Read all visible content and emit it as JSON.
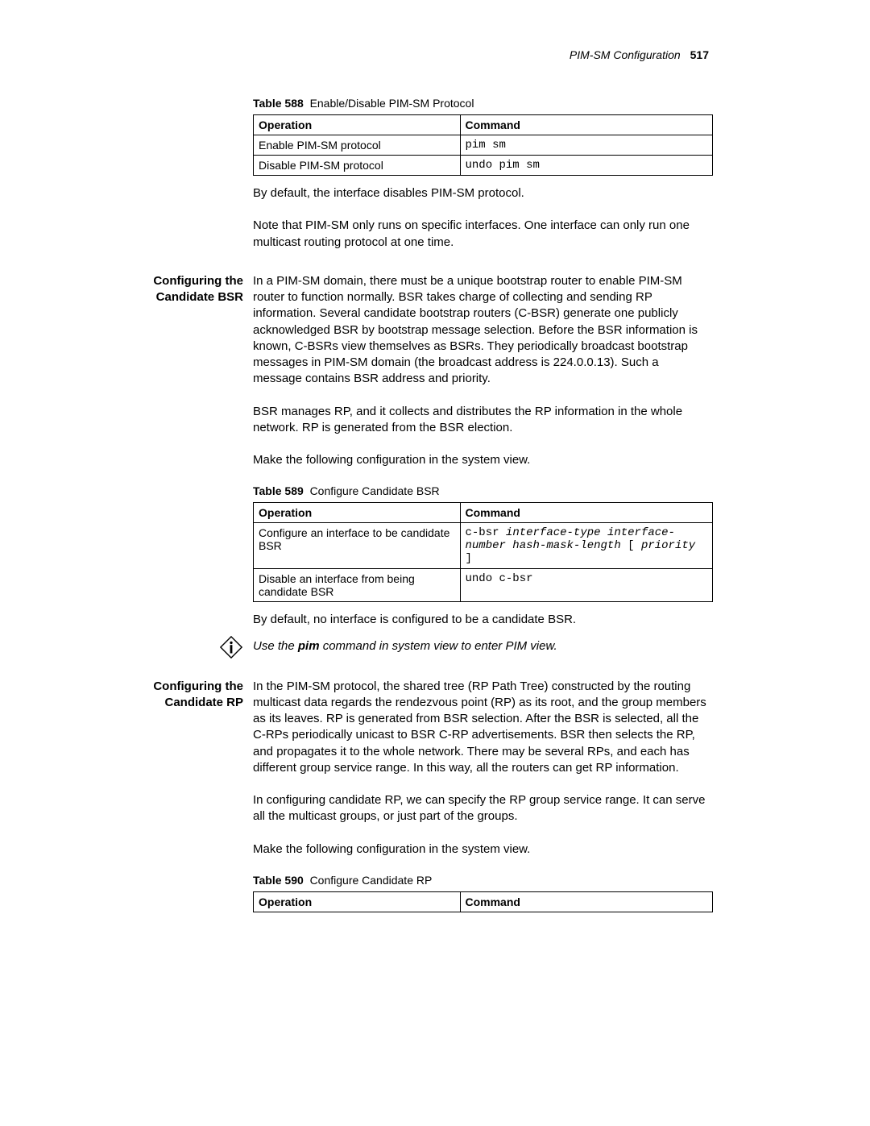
{
  "header": {
    "title": "PIM-SM Configuration",
    "page_number": "517"
  },
  "table588": {
    "label_prefix": "Table 588",
    "label_text": "Enable/Disable PIM-SM Protocol",
    "head_op": "Operation",
    "head_cmd": "Command",
    "rows": [
      {
        "op": "Enable PIM-SM protocol",
        "cmd": "pim sm"
      },
      {
        "op": "Disable PIM-SM protocol",
        "cmd": "undo pim sm"
      }
    ]
  },
  "para_default_588": "By default, the interface disables PIM-SM protocol.",
  "para_note_588": "Note that PIM-SM only runs on specific interfaces. One interface can only run one multicast routing protocol at one time.",
  "section_bsr": {
    "heading_line1": "Configuring the",
    "heading_line2": "Candidate BSR",
    "para1": "In a PIM-SM domain, there must be a unique bootstrap router to enable PIM-SM router to function normally. BSR takes charge of collecting and sending RP information. Several candidate bootstrap routers (C-BSR) generate one publicly acknowledged BSR by bootstrap message selection. Before the BSR information is known, C-BSRs view themselves as BSRs. They periodically broadcast bootstrap messages in PIM-SM domain (the broadcast address is 224.0.0.13). Such a message contains BSR address and priority.",
    "para2": "BSR manages RP, and it collects and distributes the RP information in the whole network. RP is generated from the BSR election.",
    "para3": "Make the following configuration in the system view."
  },
  "table589": {
    "label_prefix": "Table 589",
    "label_text": "Configure Candidate BSR",
    "head_op": "Operation",
    "head_cmd": "Command",
    "row1_op": "Configure an interface to be candidate BSR",
    "row1_cmd_plain1": "c-bsr ",
    "row1_cmd_ital1": "interface-type interface-number hash-mask-length",
    "row1_cmd_plain2": " [ ",
    "row1_cmd_ital2": "priority",
    "row1_cmd_plain3": " ]",
    "row2_op": "Disable an interface from being candidate BSR",
    "row2_cmd": "undo c-bsr"
  },
  "para_default_589": "By default, no interface is configured to be a candidate BSR.",
  "note": {
    "pre": "Use the ",
    "bold": "pim",
    "post": " command in system view to enter PIM view."
  },
  "section_rp": {
    "heading_line1": "Configuring the",
    "heading_line2": "Candidate RP",
    "para1": "In the PIM-SM protocol, the shared tree (RP Path Tree) constructed by the routing multicast data regards the rendezvous point (RP) as its root, and the group members as its leaves. RP is generated from BSR selection. After the BSR is selected, all the C-RPs periodically unicast to BSR C-RP advertisements. BSR then selects the RP, and propagates it to the whole network. There may be several RPs, and each has different group service range. In this way, all the routers can get RP information.",
    "para2": "In configuring candidate RP, we can specify the RP group service range. It can serve all the multicast groups, or just part of the groups.",
    "para3": "Make the following configuration in the system view."
  },
  "table590": {
    "label_prefix": "Table 590",
    "label_text": "Configure Candidate RP",
    "head_op": "Operation",
    "head_cmd": "Command"
  }
}
